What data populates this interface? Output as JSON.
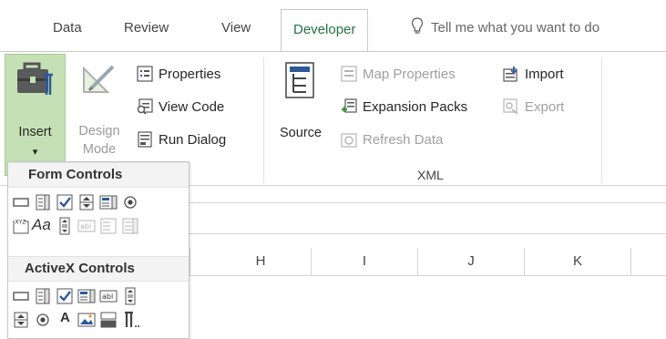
{
  "tabs": {
    "data": "Data",
    "review": "Review",
    "view": "View",
    "developer": "Developer",
    "tell_me": "Tell me what you want to do"
  },
  "ribbon": {
    "insert": {
      "line1": "Insert",
      "arrow": "▾"
    },
    "design_mode": {
      "line1": "Design",
      "line2": "Mode"
    },
    "properties": "Properties",
    "view_code": "View Code",
    "run_dialog": "Run Dialog",
    "source": "Source",
    "map_properties": "Map Properties",
    "expansion_packs": "Expansion Packs",
    "refresh_data": "Refresh Data",
    "import": "Import",
    "export": "Export",
    "xml_group": "XML"
  },
  "columns": [
    "H",
    "I",
    "J",
    "K"
  ],
  "insert_panel": {
    "form_controls": "Form Controls",
    "activex_controls": "ActiveX Controls",
    "aa_label": "Aa",
    "label_a": "A"
  },
  "colors": {
    "accent": "#217346",
    "insert_bg": "#c5e0b4",
    "icon_blue": "#2a5a9c"
  }
}
